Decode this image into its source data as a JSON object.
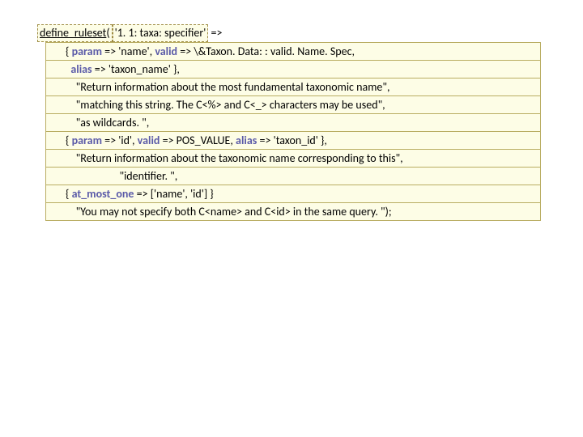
{
  "code": {
    "func": "define_ruleset",
    "arg1": "'1. 1: taxa: specifier'",
    "arrow": " =>",
    "rows": [
      "{ <k>param</k> => 'name', <k>valid</k> => \\&Taxon. Data: : valid. Name. Spec,",
      "  <k>alias</k> => 'taxon_name' },",
      "    \"Return information about the most fundamental taxonomic name\",",
      "    \"matching this string.  The C<%> and C<_> characters may be used\",",
      "    \"as wildcards. \",",
      "{ <k>param</k> => 'id', <k>valid</k> => POS_VALUE, <k>alias</k> => 'taxon_id' },",
      "    \"Return information about the taxonomic name corresponding to this\",",
      "                     \"identifier. \",",
      "{ <k>at_most_one</k> => ['name', 'id'] }",
      "    \"You may not specify both C<name> and C<id> in the same query. \");"
    ]
  }
}
